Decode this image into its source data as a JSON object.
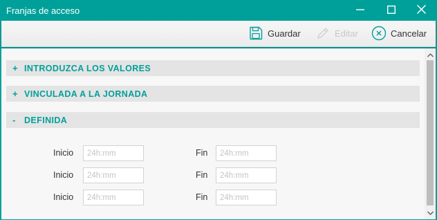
{
  "window": {
    "title": "Franjas de acceso",
    "controls": [
      "minimize-icon",
      "maximize-icon",
      "close-icon"
    ]
  },
  "toolbar": {
    "save_label": "Guardar",
    "save_icon": "floppy-disk-icon",
    "edit_label": "Editar",
    "edit_icon": "pencil-icon",
    "edit_enabled": false,
    "cancel_label": "Cancelar",
    "cancel_icon": "circle-x-icon"
  },
  "sections": [
    {
      "sign": "+",
      "label": "INTRODUZCA LOS VALORES",
      "expanded": false
    },
    {
      "sign": "+",
      "label": "VINCULADA A LA JORNADA",
      "expanded": false
    },
    {
      "sign": "-",
      "label": "DEFINIDA",
      "expanded": true
    }
  ],
  "ranges": [
    {
      "start_label": "Inicio",
      "start_value": "",
      "start_placeholder": "24h:mm",
      "end_label": "Fin",
      "end_value": "",
      "end_placeholder": "24h:mm"
    },
    {
      "start_label": "Inicio",
      "start_value": "",
      "start_placeholder": "24h:mm",
      "end_label": "Fin",
      "end_value": "",
      "end_placeholder": "24h:mm"
    },
    {
      "start_label": "Inicio",
      "start_value": "",
      "start_placeholder": "24h:mm",
      "end_label": "Fin",
      "end_value": "",
      "end_placeholder": "24h:mm"
    }
  ],
  "colors": {
    "accent": "#00a09a",
    "section_bg": "#e4e4e4",
    "disabled": "#c8c8c8"
  }
}
